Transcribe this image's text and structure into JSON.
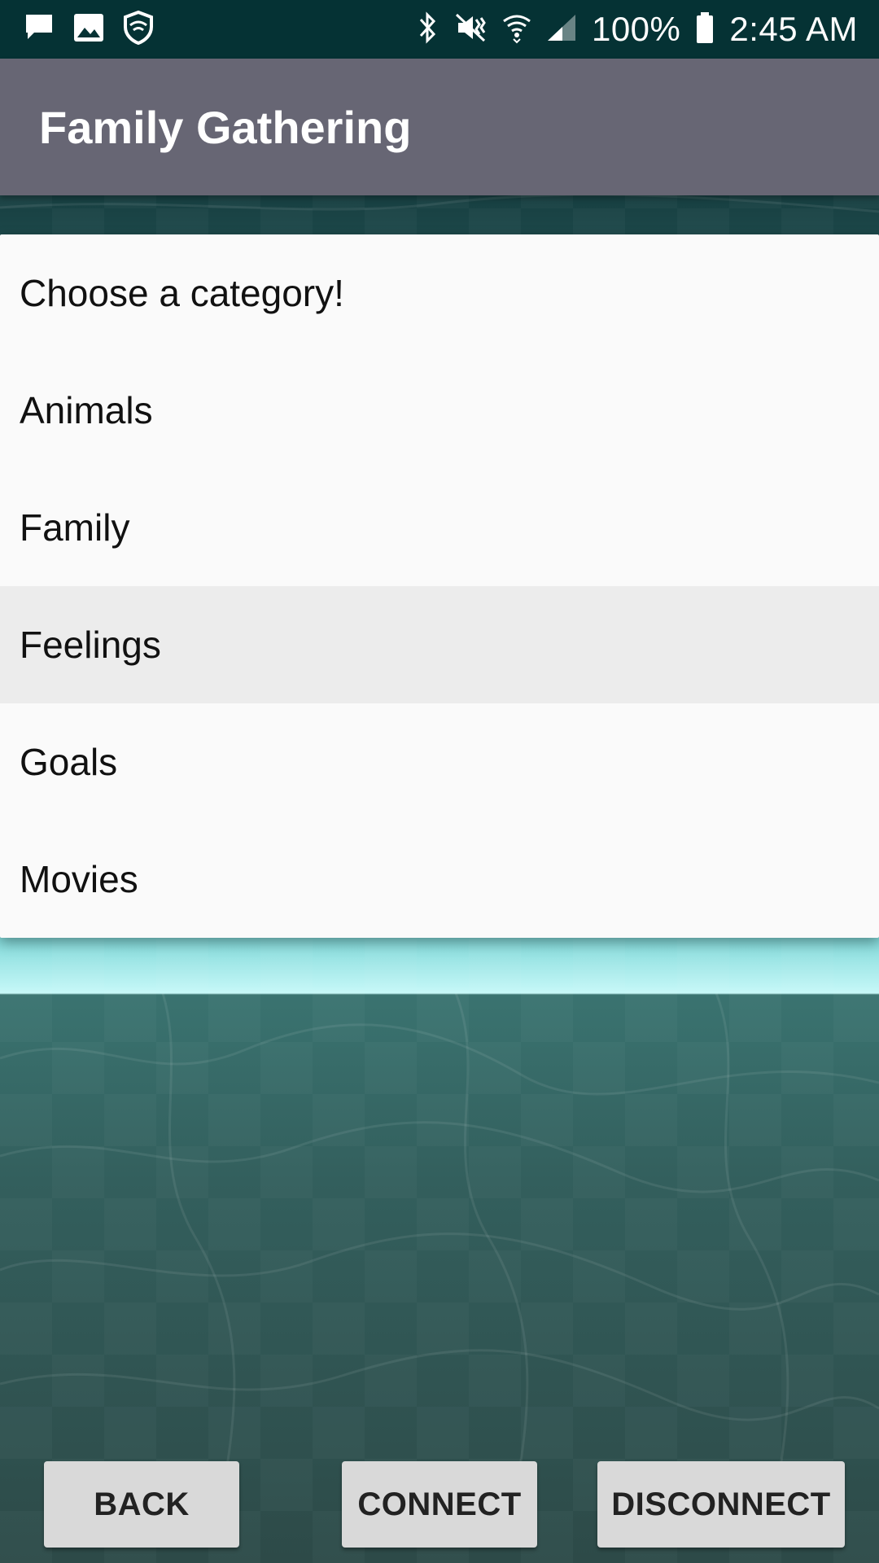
{
  "status_bar": {
    "battery": "100%",
    "time": "2:45 AM",
    "icons_left": [
      "message-icon",
      "image-icon",
      "shield-icon"
    ],
    "icons_right": [
      "bluetooth-icon",
      "vibrate-icon",
      "wifi-icon",
      "signal-icon",
      "battery-icon"
    ]
  },
  "app": {
    "title": "Family Gathering"
  },
  "category_dropdown": {
    "items": [
      {
        "label": "Choose a category!"
      },
      {
        "label": "Animals"
      },
      {
        "label": "Family"
      },
      {
        "label": "Feelings",
        "selected": true
      },
      {
        "label": "Goals"
      },
      {
        "label": "Movies"
      }
    ]
  },
  "buttons": {
    "back": "BACK",
    "connect": "CONNECT",
    "disconnect": "DISCONNECT"
  },
  "colors": {
    "status_bar": "#053234",
    "app_bar": "#676674",
    "dropdown_bg": "#fafafa",
    "dropdown_selected": "#ececec",
    "button_bg": "#d9d9d9"
  }
}
